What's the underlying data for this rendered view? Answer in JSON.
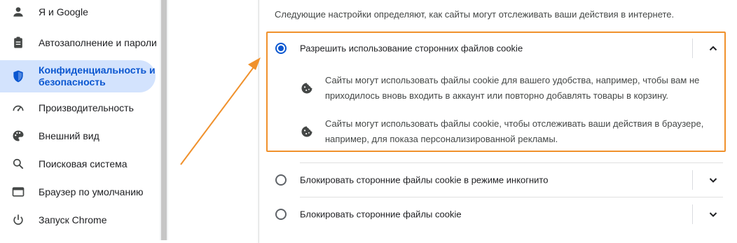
{
  "sidebar": {
    "items": [
      {
        "label": "Я и Google",
        "icon": "person-icon"
      },
      {
        "label": "Автозаполнение и пароли",
        "icon": "clipboard-icon"
      },
      {
        "label": "Конфиденциальность и безопасность",
        "icon": "shield-icon",
        "active": true
      },
      {
        "label": "Производительность",
        "icon": "speedometer-icon"
      },
      {
        "label": "Внешний вид",
        "icon": "palette-icon"
      },
      {
        "label": "Поисковая система",
        "icon": "search-icon"
      },
      {
        "label": "Браузер по умолчанию",
        "icon": "browser-icon"
      },
      {
        "label": "Запуск Chrome",
        "icon": "power-icon"
      }
    ]
  },
  "main": {
    "description": "Следующие настройки определяют, как сайты могут отслеживать ваши действия в интернете.",
    "options": [
      {
        "label": "Разрешить использование сторонних файлов cookie",
        "selected": true,
        "expanded": true,
        "details": [
          "Сайты могут использовать файлы cookie для вашего удобства, например, чтобы вам не приходилось вновь входить в аккаунт или повторно добавлять товары в корзину.",
          "Сайты могут использовать файлы cookie, чтобы отслеживать ваши действия в браузере, например, для показа персонализированной рекламы."
        ]
      },
      {
        "label": "Блокировать сторонние файлы cookie в режиме инкогнито",
        "selected": false,
        "expanded": false
      },
      {
        "label": "Блокировать сторонние файлы cookie",
        "selected": false,
        "expanded": false
      }
    ]
  },
  "colors": {
    "accent": "#0b57d0",
    "active_bg": "#d3e3fd",
    "annotation": "#f0912c"
  }
}
